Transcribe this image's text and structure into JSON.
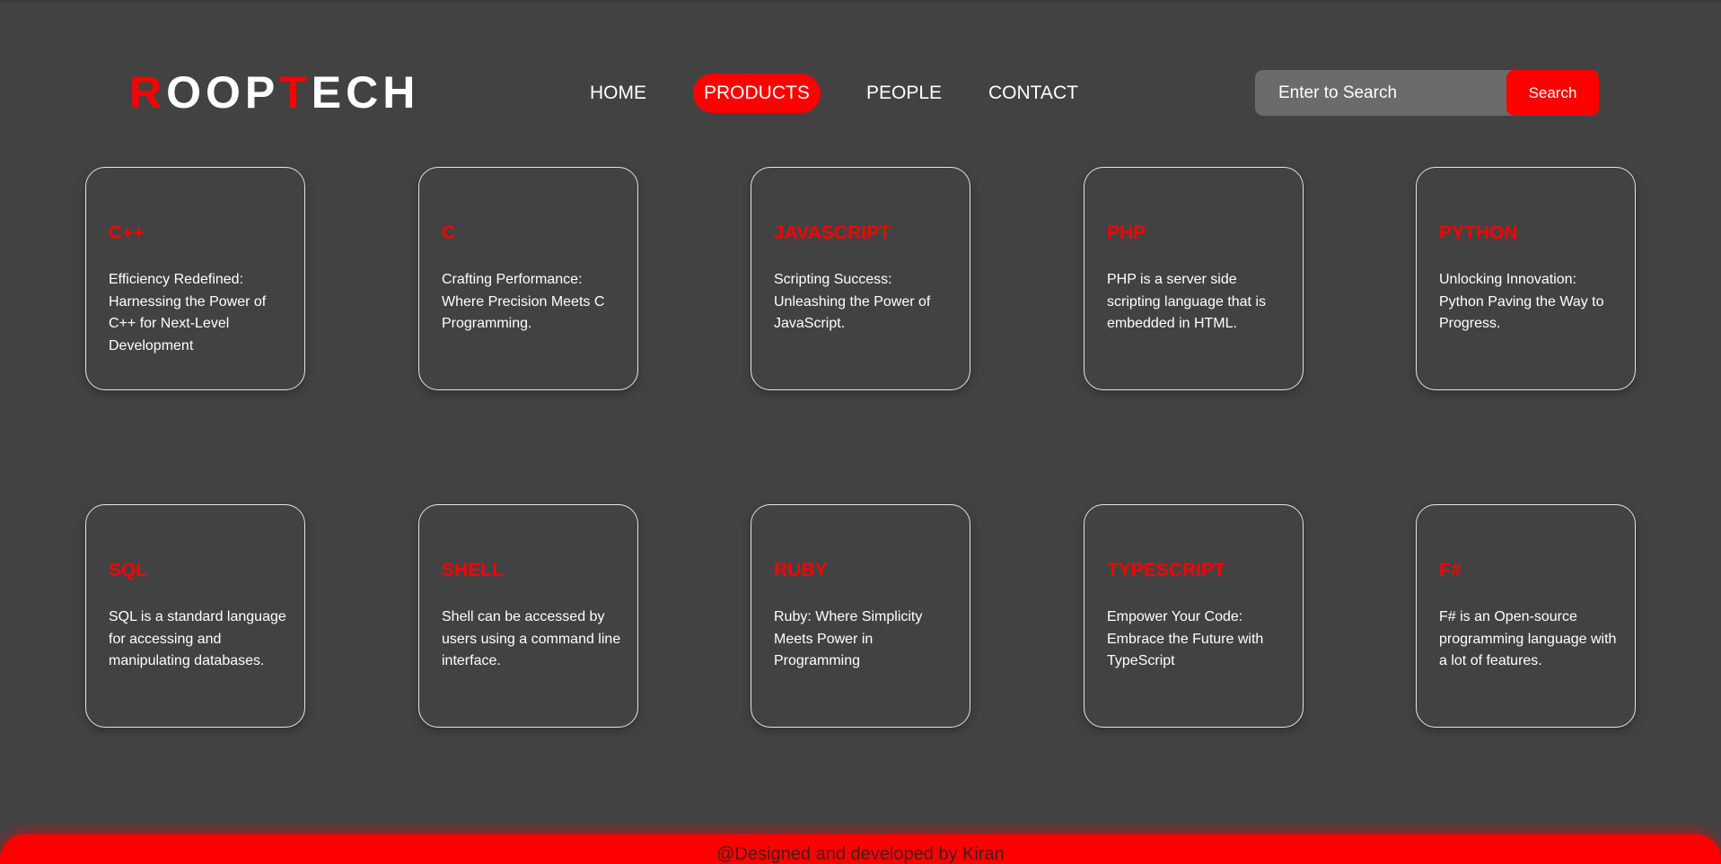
{
  "logo": {
    "part1_accent": "R",
    "part2": "OOP",
    "part3_accent": "T",
    "part4": "ECH"
  },
  "nav": {
    "items": [
      {
        "label": "HOME",
        "active": false
      },
      {
        "label": "PRODUCTS",
        "active": true
      },
      {
        "label": "PEOPLE",
        "active": false
      },
      {
        "label": "CONTACT",
        "active": false
      }
    ]
  },
  "search": {
    "placeholder": "Enter to Search",
    "button_label": "Search"
  },
  "cards": [
    {
      "title": "C++",
      "description": "Efficiency Redefined: Harnessing the Power of C++ for Next-Level Development"
    },
    {
      "title": "C",
      "description": "Crafting Performance: Where Precision Meets C Programming."
    },
    {
      "title": "JAVASCRIPT",
      "description": "Scripting Success: Unleashing the Power of JavaScript."
    },
    {
      "title": "PHP",
      "description": "PHP is a server side scripting language that is embedded in HTML."
    },
    {
      "title": "PYTHON",
      "description": "Unlocking Innovation: Python Paving the Way to Progress."
    },
    {
      "title": "SQL",
      "description": "SQL is a standard language for accessing and manipulating databases."
    },
    {
      "title": "SHELL",
      "description": "Shell can be accessed by users using a command line interface."
    },
    {
      "title": "RUBY",
      "description": "Ruby: Where Simplicity Meets Power in Programming"
    },
    {
      "title": "TYPESCRIPT",
      "description": "Empower Your Code: Embrace the Future with TypeScript"
    },
    {
      "title": "F#",
      "description": "F# is an Open-source programming language with a lot of features."
    }
  ],
  "footer": {
    "text": "@Designed and developed by Kiran"
  },
  "colors": {
    "background": "#424242",
    "accent": "#ff0000",
    "text": "#ffffff",
    "search_field": "#6b6b6b"
  }
}
